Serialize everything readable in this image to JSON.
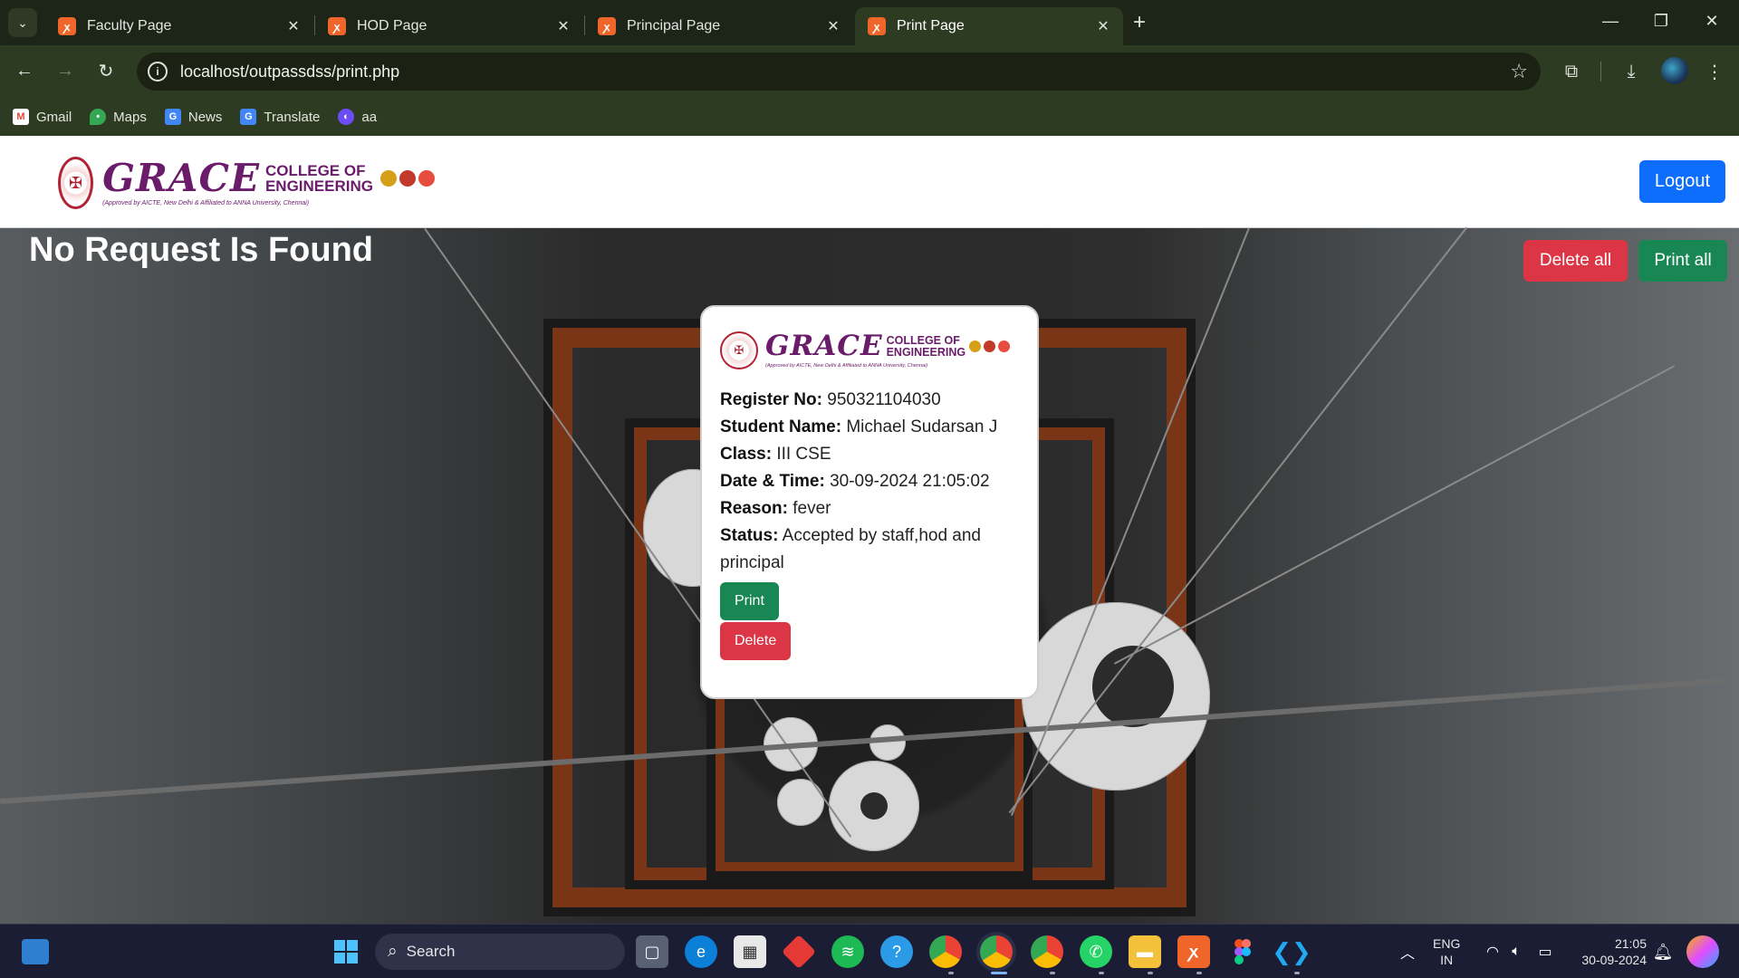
{
  "browser": {
    "tabs": [
      {
        "title": "Faculty Page",
        "active": false
      },
      {
        "title": "HOD Page",
        "active": false
      },
      {
        "title": "Principal Page",
        "active": false
      },
      {
        "title": "Print Page",
        "active": true
      }
    ],
    "url": "localhost/outpassdss/print.php",
    "bookmarks": [
      {
        "label": "Gmail",
        "icon": "gmail-icon"
      },
      {
        "label": "Maps",
        "icon": "maps-icon"
      },
      {
        "label": "News",
        "icon": "news-icon"
      },
      {
        "label": "Translate",
        "icon": "translate-icon"
      },
      {
        "label": "aa",
        "icon": "bookmark-app-icon"
      }
    ]
  },
  "header": {
    "brand_name": "GRACE",
    "brand_line1": "COLLEGE OF",
    "brand_line2": "ENGINEERING",
    "brand_tagline": "(Approved by AICTE, New Delhi & Affiliated to ANNA University, Chennai)",
    "logout_label": "Logout"
  },
  "main": {
    "notice": "No Request Is Found",
    "delete_all_label": "Delete all",
    "print_all_label": "Print all"
  },
  "request_card": {
    "register_no_label": "Register No:",
    "register_no": "950321104030",
    "student_name_label": "Student Name:",
    "student_name": "Michael Sudarsan J",
    "class_label": "Class:",
    "class": "III CSE",
    "datetime_label": "Date & Time:",
    "datetime": "30-09-2024 21:05:02",
    "reason_label": "Reason:",
    "reason": "fever",
    "status_label": "Status:",
    "status": "Accepted by staff,hod and principal",
    "print_label": "Print",
    "delete_label": "Delete"
  },
  "taskbar": {
    "search_placeholder": "Search",
    "lang_line1": "ENG",
    "lang_line2": "IN",
    "time": "21:05",
    "date": "30-09-2024"
  },
  "colors": {
    "primary": "#0d6efd",
    "danger": "#dc3545",
    "success": "#198754",
    "brand_purple": "#6a1b6a",
    "browser_dark": "#2e3b23"
  }
}
